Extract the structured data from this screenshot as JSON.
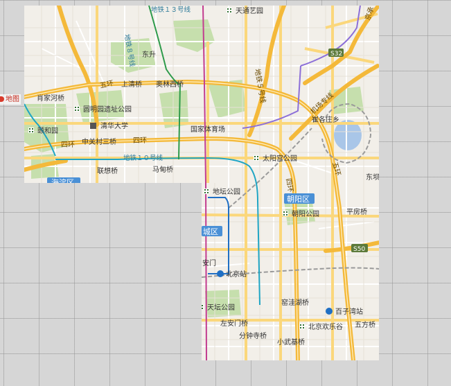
{
  "side_label": "地图",
  "colors": {
    "land": "#f2efe9",
    "park": "#c6dfad",
    "major_road": "#f4b93a",
    "arterial": "#fbd77b",
    "street": "#ffffff",
    "subway_10": "#1fa5c4",
    "subway_8": "#2d9a4a",
    "subway_13": "#f4b93a",
    "subway_5": "#c23c8f",
    "airport_express": "#8c6fd8",
    "railway": "#9a9a9a",
    "district_badge": "#4a90d6"
  },
  "map_labels": {
    "tiantongyuan": "天通艺园",
    "line13": "地铁１３号线",
    "jingcheng": "京承",
    "dongsheng": "东升",
    "line8": "地铁８号线",
    "line5": "地铁５号线",
    "s32": "S32",
    "wuhuan_n": "五环",
    "shangqingqiao": "上清桥",
    "aolinxiqiao": "奥林西桥",
    "airport_line": "机场专线",
    "xiaojiahe": "肖家河桥",
    "yuanmingyuan": "圆明园遗址公园",
    "qinghua": "清华大学",
    "yiheyuan": "颐和园",
    "cuigezhuang": "崔各庄乡",
    "guojiatiyuchang": "国家体育场",
    "sihuan_w": "四环",
    "zhongguancun": "中关村三桥",
    "sihuan_n": "四环",
    "line10": "地铁１０号线",
    "taiyanggong": "太阳宫公园",
    "lianxiangqiao": "联想桥",
    "madianqiao": "马甸桥",
    "wuhuan_e": "五环",
    "haidian": "海淀区",
    "ditan": "地坛公园",
    "sihuan_e": "四环",
    "chaoyang": "朝阳区",
    "dongba": "东坝",
    "chaoyanggongyuan": "朝阳公园",
    "pingfangqiao": "平房桥",
    "dongcheng": "城区",
    "s50": "S50",
    "andingmen": "安门",
    "beijingzhan": "北京站",
    "jiaoguanghu": "窑洼湖桥",
    "baiziwan": "百子湾站",
    "tiantan": "天坛公园",
    "zuoanmen": "左安门桥",
    "huanlegu": "北京欢乐谷",
    "wufangqiao": "五方桥",
    "fenzhongsi": "分钟寺桥",
    "xiaowuji": "小武基桥"
  }
}
